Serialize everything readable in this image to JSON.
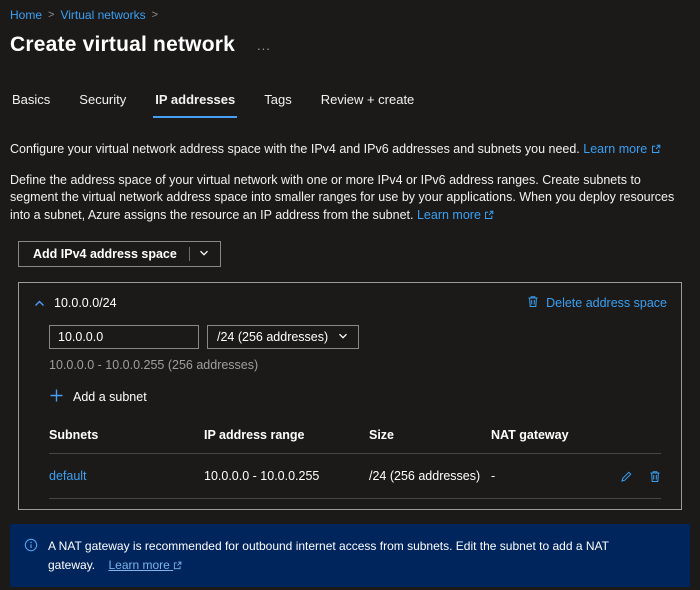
{
  "colors": {
    "link": "#3aa0f3",
    "accent": "#479ef5",
    "banner_bg": "#00245c",
    "page_bg": "#1b1a19"
  },
  "breadcrumb": {
    "items": [
      {
        "label": "Home"
      },
      {
        "label": "Virtual networks"
      }
    ]
  },
  "header": {
    "title": "Create virtual network",
    "ellipsis": "..."
  },
  "tabs": [
    {
      "label": "Basics"
    },
    {
      "label": "Security"
    },
    {
      "label": "IP addresses",
      "active": true
    },
    {
      "label": "Tags"
    },
    {
      "label": "Review + create"
    }
  ],
  "intro": {
    "text": "Configure your virtual network address space with the IPv4 and IPv6 addresses and subnets you need.",
    "learn_more_label": "Learn more"
  },
  "description": {
    "text": "Define the address space of your virtual network with one or more IPv4 or IPv6 address ranges. Create subnets to segment the virtual network address space into smaller ranges for use by your applications. When you deploy resources into a subnet, Azure assigns the resource an IP address from the subnet.",
    "learn_more_label": "Learn more"
  },
  "toolbar": {
    "add_address_space_label": "Add IPv4 address space"
  },
  "address_space": {
    "title": "10.0.0.0/24",
    "delete_label": "Delete address space",
    "address_value": "10.0.0.0",
    "size_value": "/24 (256 addresses)",
    "range_text": "10.0.0.0 - 10.0.0.255 (256 addresses)",
    "add_subnet_label": "Add a subnet",
    "table": {
      "headers": [
        "Subnets",
        "IP address range",
        "Size",
        "NAT gateway"
      ],
      "rows": [
        {
          "name": "default",
          "range": "10.0.0.0 - 10.0.0.255",
          "size": "/24 (256 addresses)",
          "nat_gateway": "-"
        }
      ]
    }
  },
  "banner": {
    "text": "A NAT gateway is recommended for outbound internet access from subnets. Edit the subnet to add a NAT gateway.",
    "learn_more_label": "Learn more"
  }
}
